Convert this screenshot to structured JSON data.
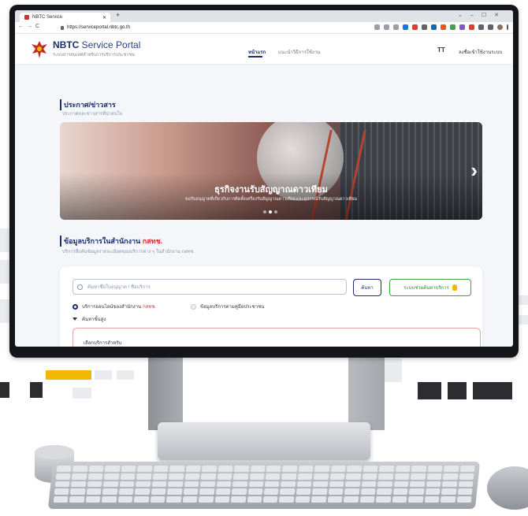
{
  "browser": {
    "tab_title": "NBTC Service",
    "url": "https://serviceportal.nbtc.go.th"
  },
  "site": {
    "brand_bold": "NBTC",
    "brand_rest": "Service Portal",
    "brand_sub": "ระบบสารสนเทศสำหรับการบริการประชาชน",
    "menu_home": "หน้าแรก",
    "menu_guide": "แนะนำวิธีการใช้งาน",
    "font_toggle": "TT",
    "register": "ลงชื่อเข้าใช้งานระบบ"
  },
  "announce": {
    "title": "ประกาศ/ข่าวสาร",
    "subtitle": "ประกาศและข่าวสารที่น่าสนใจ",
    "banner_title": "ธุรกิจงานรับสัญญาณดาวเทียม",
    "banner_sub": "ขอรับอนุญาตที่เกี่ยวกับการติดตั้งเครื่องรับสัญญาณดาวเทียมและอุปกรณ์รับสัญญาณดาวเทียม"
  },
  "services": {
    "title": "ข้อมูลบริการในสำนักงาน",
    "title_accent": "กสทช.",
    "subtitle": "บริการสืบค้นข้อมูลรายละเอียดของบริการต่าง ๆ ในสำนักงาน กสทช.",
    "search_placeholder": "ค้นหาชื่อใบอนุญาต / ชื่อบริการ",
    "search_button": "ค้นหา",
    "help_button": "ระบบช่วยค้นหาบริการ",
    "radio_online": "บริการออนไลน์ของสำนักงาน",
    "radio_online_accent": "กสทช.",
    "radio_manual": "ข้อมูลบริการตามคู่มือประชาชน",
    "advanced": "ค้นหาขั้นสูง",
    "select_label": "เลือกบริการสำหรับ"
  }
}
